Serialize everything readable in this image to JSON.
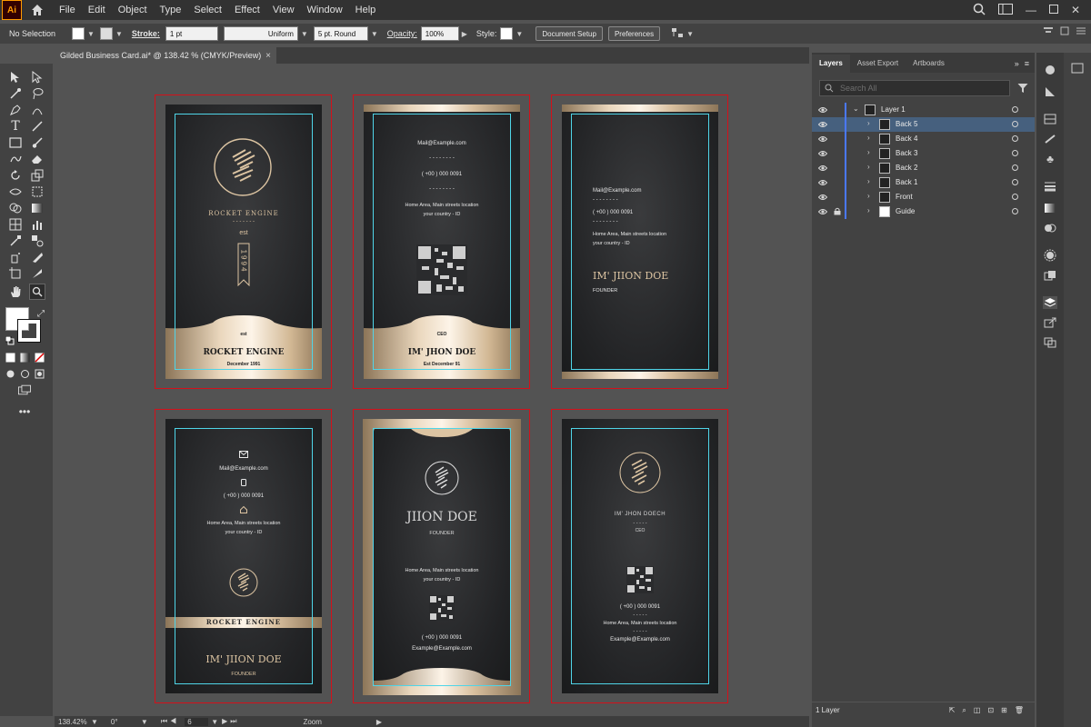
{
  "app": {
    "logo": "Ai"
  },
  "menu": [
    "File",
    "Edit",
    "Object",
    "Type",
    "Select",
    "Effect",
    "View",
    "Window",
    "Help"
  ],
  "control": {
    "selection": "No Selection",
    "stroke_label": "Stroke:",
    "stroke_weight": "1 pt",
    "stroke_profile": "Uniform",
    "brush": "5 pt. Round",
    "opacity_label": "Opacity:",
    "opacity": "100%",
    "style_label": "Style:",
    "doc_setup": "Document Setup",
    "preferences": "Preferences"
  },
  "document_tab": {
    "title": "Gilded Business Card.ai* @ 138.42 % (CMYK/Preview)",
    "close": "×"
  },
  "cards": {
    "c1": {
      "brand": "ROCKET ENGINE",
      "est": "est",
      "year": "1994",
      "rocket": "ROCKET ENGINE",
      "date": "December 1991",
      "dashes": "- - - - - - -"
    },
    "c2": {
      "mail": "Mail@Example.com",
      "dashes": "- - - - - - - -",
      "phone": "( +00 ) 000 0091",
      "address1": "Home Area, Main streets location",
      "address2": "your country - ID",
      "role": "CEO",
      "name": "IM' JHON DOE",
      "est": "Est December 91"
    },
    "c3": {
      "mail": "Mail@Example.com",
      "dashes": "- - - - - - - -",
      "phone": "( +00 ) 000 0091",
      "address1": "Home Area, Main streets location",
      "address2": "your country - ID",
      "name": "IM' JIION DOE",
      "title": "FOUNDER"
    },
    "c4": {
      "mail": "Mail@Example.com",
      "phone": "( +00 ) 000 0091",
      "address1": "Home Area, Main streets location",
      "address2": "your country - ID",
      "band": "ROCKET ENGINE",
      "name": "IM' JIION DOE",
      "title": "FOUNDER"
    },
    "c5": {
      "name": "JIION DOE",
      "title": "FOUNDER",
      "address1": "Home Area, Main streets location",
      "address2": "your country - ID",
      "phone": "( +00 ) 000 0091",
      "mail": "Example@Example.com"
    },
    "c6": {
      "name": "IM' JHON DOECH",
      "dashes": "- - - - -",
      "role": "CEO",
      "phone": "( +00 ) 000 0091",
      "address1": "Home Area, Main streets location",
      "mail": "Example@Example.com"
    }
  },
  "layers_panel": {
    "tabs": [
      "Layers",
      "Asset Export",
      "Artboards"
    ],
    "search_placeholder": "Search All",
    "layers": [
      {
        "name": "Layer 1",
        "level": 0,
        "selected": false,
        "locked": false
      },
      {
        "name": "Back 5",
        "level": 1,
        "selected": true,
        "locked": false
      },
      {
        "name": "Back 4",
        "level": 1,
        "selected": false,
        "locked": false
      },
      {
        "name": "Back 3",
        "level": 1,
        "selected": false,
        "locked": false
      },
      {
        "name": "Back 2",
        "level": 1,
        "selected": false,
        "locked": false
      },
      {
        "name": "Back 1",
        "level": 1,
        "selected": false,
        "locked": false
      },
      {
        "name": "Front",
        "level": 1,
        "selected": false,
        "locked": false
      },
      {
        "name": "Guide",
        "level": 1,
        "selected": false,
        "locked": true
      }
    ],
    "footer": "1 Layer"
  },
  "status": {
    "zoom": "138.42%",
    "rotate": "0°",
    "artboard": "6",
    "tool": "Zoom"
  },
  "colors": {
    "artboard_border": "#d4101a",
    "guide": "#4fd5e8",
    "gold": "#e9d6bc",
    "layer_selected": "#46607e"
  }
}
